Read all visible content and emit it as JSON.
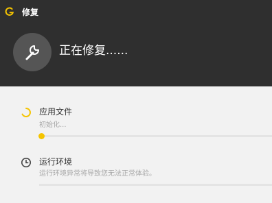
{
  "window": {
    "title": "修复"
  },
  "header": {
    "status_title": "正在修复......"
  },
  "items": [
    {
      "icon": "spinner-icon",
      "label": "应用文件",
      "status": "初始化...",
      "progress": 0.02
    },
    {
      "icon": "clock-icon",
      "label": "运行环境",
      "status": "运行环境异常将导致您无法正常体验。",
      "progress": 0
    }
  ],
  "colors": {
    "accent": "#f5c400",
    "header_bg": "#2f2f2f",
    "content_bg": "#f2f2f2"
  }
}
